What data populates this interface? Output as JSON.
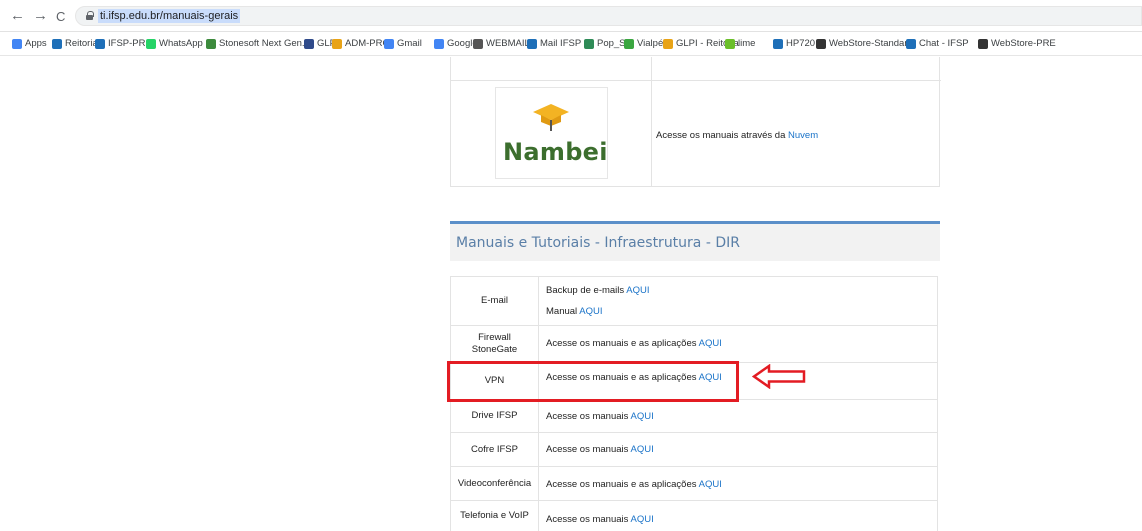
{
  "browser": {
    "url": "ti.ifsp.edu.br/manuais-gerais",
    "back_glyph": "←",
    "forward_glyph": "→",
    "reload_glyph": "C"
  },
  "bookmarks": [
    {
      "label": "Apps",
      "icon": "apps-grid-icon",
      "color": "#4285f4"
    },
    {
      "label": "Reitoria",
      "icon": "folder-icon",
      "color": "#1e6fb8"
    },
    {
      "label": "IFSP-PRC",
      "icon": "folder-icon",
      "color": "#1e6fb8"
    },
    {
      "label": "WhatsApp",
      "icon": "whatsapp-icon",
      "color": "#25d366"
    },
    {
      "label": "Stonesoft Next Gen...",
      "icon": "stonesoft-icon",
      "color": "#3c8a3c"
    },
    {
      "label": "GLPI",
      "icon": "glpi-icon",
      "color": "#2f4a8a"
    },
    {
      "label": "ADM-PRC",
      "icon": "adm-icon",
      "color": "#e8a317"
    },
    {
      "label": "Gmail",
      "icon": "google-icon",
      "color": "#4285f4"
    },
    {
      "label": "Google",
      "icon": "google-icon",
      "color": "#4285f4"
    },
    {
      "label": "WEBMAIL",
      "icon": "webmail-icon",
      "color": "#555555"
    },
    {
      "label": "Mail IFSP",
      "icon": "mail-icon",
      "color": "#1e6fb8"
    },
    {
      "label": "Pop_SP",
      "icon": "pop-icon",
      "color": "#2e8b57"
    },
    {
      "label": "Vialpé",
      "icon": "vialpe-icon",
      "color": "#3aa640"
    },
    {
      "label": "GLPI - Reitoria",
      "icon": "glpi-icon",
      "color": "#e8a317"
    },
    {
      "label": "lime",
      "icon": "lime-icon",
      "color": "#6bbf2a"
    },
    {
      "label": "HP720",
      "icon": "hp-icon",
      "color": "#1e6fb8"
    },
    {
      "label": "WebStore-Standart",
      "icon": "webstore-icon",
      "color": "#333333"
    },
    {
      "label": "Chat - IFSP",
      "icon": "chat-icon",
      "color": "#1e6fb8"
    },
    {
      "label": "WebStore-PRE",
      "icon": "webstore-icon",
      "color": "#333333"
    }
  ],
  "top_block": {
    "logo_text": "Nambei",
    "text_prefix": "Acesse os manuais através da ",
    "link": "Nuvem"
  },
  "section": {
    "title": "Manuais e Tutoriais - Infraestrutura - DIR"
  },
  "rows": [
    {
      "name": "E-mail",
      "lines": [
        {
          "text": "Backup de e-mails ",
          "link": "AQUI"
        },
        {
          "text": "Manual ",
          "link": "AQUI"
        }
      ]
    },
    {
      "name": "Firewall StoneGate",
      "lines": [
        {
          "text": "Acesse os manuais e as aplicações ",
          "link": "AQUI"
        }
      ]
    },
    {
      "name": "VPN",
      "lines": [
        {
          "text": "Acesse os manuais e as aplicações ",
          "link": "AQUI"
        }
      ]
    },
    {
      "name": "Drive IFSP",
      "lines": [
        {
          "text": "Acesse os manuais ",
          "link": "AQUI"
        }
      ]
    },
    {
      "name": "Cofre IFSP",
      "lines": [
        {
          "text": "Acesse os manuais ",
          "link": "AQUI"
        }
      ]
    },
    {
      "name": "Videoconferência",
      "lines": [
        {
          "text": "Acesse os manuais e as aplicações ",
          "link": "AQUI"
        }
      ]
    },
    {
      "name": "Telefonia e VoIP",
      "lines": [
        {
          "text": "Acesse os manuais ",
          "link": "AQUI"
        }
      ]
    }
  ],
  "annotation": {
    "highlight_color": "#e31c23"
  }
}
